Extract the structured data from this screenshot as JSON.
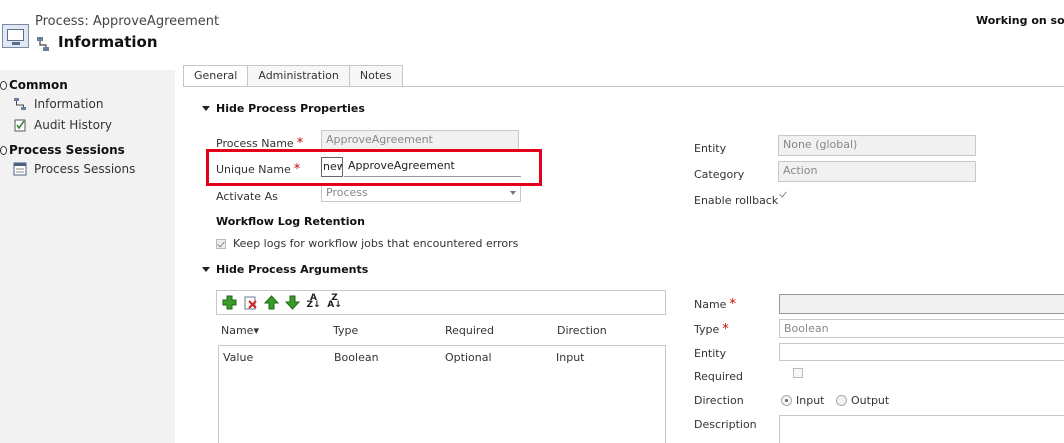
{
  "header": {
    "process_title": "Process: ApproveAgreement",
    "page_title": "Information",
    "status": "Working on solu"
  },
  "nav": {
    "groups": [
      {
        "label": "Common",
        "items": [
          {
            "label": "Information",
            "icon": "flow-icon"
          },
          {
            "label": "Audit History",
            "icon": "audit-icon"
          }
        ]
      },
      {
        "label": "Process Sessions",
        "items": [
          {
            "label": "Process Sessions",
            "icon": "sessions-icon"
          }
        ]
      }
    ]
  },
  "tabs": [
    "General",
    "Administration",
    "Notes"
  ],
  "properties": {
    "section_title": "Hide Process Properties",
    "process_name_label": "Process Name",
    "process_name_value": "ApproveAgreement",
    "unique_name_label": "Unique Name",
    "unique_name_prefix": "new_",
    "unique_name_value": "ApproveAgreement",
    "activate_as_label": "Activate As",
    "activate_as_value": "Process",
    "log_retention_title": "Workflow Log Retention",
    "keep_logs_label": "Keep logs for workflow jobs that encountered errors",
    "entity_label": "Entity",
    "entity_value": "None (global)",
    "category_label": "Category",
    "category_value": "Action",
    "enable_rollback_label": "Enable rollback"
  },
  "arguments": {
    "section_title": "Hide Process Arguments",
    "columns": [
      "Name",
      "Type",
      "Required",
      "Direction"
    ],
    "rows": [
      {
        "name": "Value",
        "type": "Boolean",
        "required": "Optional",
        "direction": "Input"
      }
    ],
    "detail": {
      "name_label": "Name",
      "name_value": "",
      "type_label": "Type",
      "type_value": "Boolean",
      "entity_label": "Entity",
      "required_label": "Required",
      "direction_label": "Direction",
      "direction_options": [
        "Input",
        "Output"
      ],
      "description_label": "Description"
    }
  },
  "colors": {
    "highlight": "#e2001a",
    "required": "#cc0000",
    "nav_bg": "#f2f2f2"
  }
}
